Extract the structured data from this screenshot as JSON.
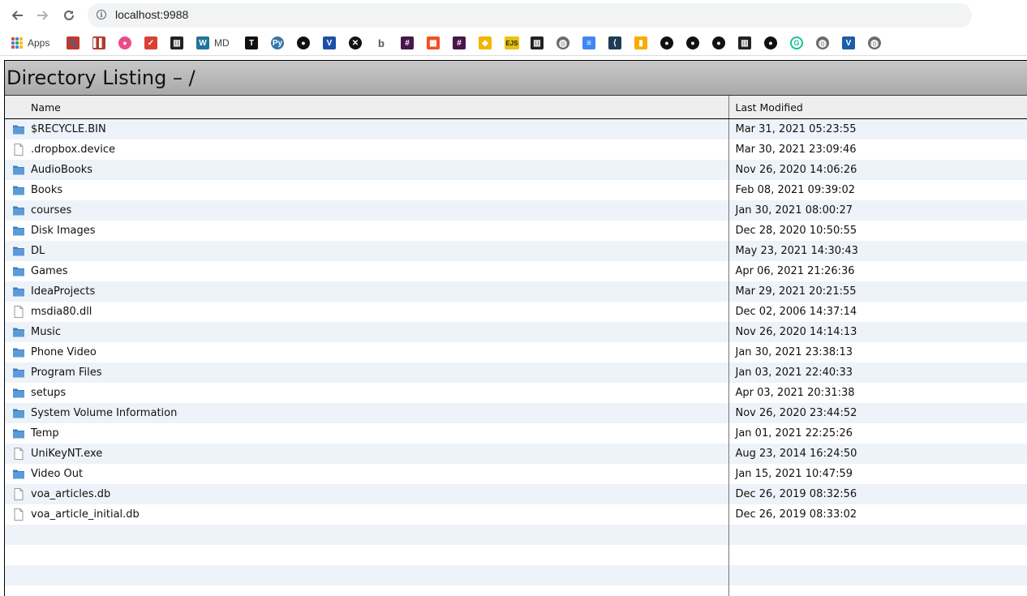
{
  "browser": {
    "url": "localhost:9988",
    "bookmarks": [
      {
        "label": "Apps",
        "icon": "apps-grid-icon"
      },
      {
        "label": "",
        "icon": "paw-icon",
        "color": "#c0392b",
        "glyph": "🐾"
      },
      {
        "label": "",
        "icon": "bars-icon",
        "color": "#b03a2e",
        "glyph": "▌▌"
      },
      {
        "label": "",
        "icon": "dribbble-icon",
        "color": "#ea4c89",
        "glyph": "●"
      },
      {
        "label": "",
        "icon": "check-icon",
        "color": "#db4035",
        "glyph": "✓"
      },
      {
        "label": "",
        "icon": "museum-icon",
        "color": "#222222",
        "glyph": "▥"
      },
      {
        "label": "MD",
        "icon": "wordpress-icon",
        "color": "#21759b",
        "glyph": "W"
      },
      {
        "label": "",
        "icon": "tb-icon",
        "color": "#111111",
        "glyph": "T"
      },
      {
        "label": "",
        "icon": "python-icon",
        "color": "#3776ab",
        "glyph": "Py"
      },
      {
        "label": "",
        "icon": "github-icon",
        "color": "#111111",
        "glyph": "●"
      },
      {
        "label": "",
        "icon": "v-icon",
        "color": "#1e4fa8",
        "glyph": "V"
      },
      {
        "label": "",
        "icon": "x-icon",
        "color": "#111111",
        "glyph": "✕"
      },
      {
        "label": "",
        "icon": "b-icon",
        "color": "#555555",
        "glyph": "b"
      },
      {
        "label": "",
        "icon": "slack-icon",
        "color": "#4a154b",
        "glyph": "#"
      },
      {
        "label": "",
        "icon": "microsoft-icon",
        "color": "#f25022",
        "glyph": "▦"
      },
      {
        "label": "",
        "icon": "hash-icon",
        "color": "#4a154b",
        "glyph": "#"
      },
      {
        "label": "",
        "icon": "bag-icon",
        "color": "#f4b400",
        "glyph": "◆"
      },
      {
        "label": "",
        "icon": "ejs-icon",
        "color": "#e8c20c",
        "glyph": "EJS"
      },
      {
        "label": "",
        "icon": "museum-icon",
        "color": "#222222",
        "glyph": "▥"
      },
      {
        "label": "",
        "icon": "globe-icon",
        "color": "#6b6b6b",
        "glyph": "◍"
      },
      {
        "label": "",
        "icon": "docs-icon",
        "color": "#4285f4",
        "glyph": "≡"
      },
      {
        "label": "",
        "icon": "vscode-icon",
        "color": "#1f3b57",
        "glyph": "⟨"
      },
      {
        "label": "",
        "icon": "analytics-icon",
        "color": "#f9ab00",
        "glyph": "▮"
      },
      {
        "label": "",
        "icon": "github-icon",
        "color": "#111111",
        "glyph": "●"
      },
      {
        "label": "",
        "icon": "github-icon",
        "color": "#111111",
        "glyph": "●"
      },
      {
        "label": "",
        "icon": "github-icon",
        "color": "#111111",
        "glyph": "●"
      },
      {
        "label": "",
        "icon": "museum-icon",
        "color": "#222222",
        "glyph": "▥"
      },
      {
        "label": "",
        "icon": "github-icon",
        "color": "#111111",
        "glyph": "●"
      },
      {
        "label": "",
        "icon": "grammarly-icon",
        "color": "#15c39a",
        "glyph": "G"
      },
      {
        "label": "",
        "icon": "globe-icon",
        "color": "#6b6b6b",
        "glyph": "◍"
      },
      {
        "label": "",
        "icon": "voa-icon",
        "color": "#1a5fa8",
        "glyph": "V"
      },
      {
        "label": "",
        "icon": "globe-icon",
        "color": "#6b6b6b",
        "glyph": "◍"
      }
    ]
  },
  "listing": {
    "title": "Directory Listing – /",
    "columns": {
      "name": "Name",
      "modified": "Last Modified"
    },
    "rows": [
      {
        "name": "$RECYCLE.BIN",
        "modified": "Mar 31, 2021 05:23:55",
        "type": "folder"
      },
      {
        "name": ".dropbox.device",
        "modified": "Mar 30, 2021 23:09:46",
        "type": "file"
      },
      {
        "name": "AudioBooks",
        "modified": "Nov 26, 2020 14:06:26",
        "type": "folder"
      },
      {
        "name": "Books",
        "modified": "Feb 08, 2021 09:39:02",
        "type": "folder"
      },
      {
        "name": "courses",
        "modified": "Jan 30, 2021 08:00:27",
        "type": "folder"
      },
      {
        "name": "Disk Images",
        "modified": "Dec 28, 2020 10:50:55",
        "type": "folder"
      },
      {
        "name": "DL",
        "modified": "May 23, 2021 14:30:43",
        "type": "folder"
      },
      {
        "name": "Games",
        "modified": "Apr 06, 2021 21:26:36",
        "type": "folder"
      },
      {
        "name": "IdeaProjects",
        "modified": "Mar 29, 2021 20:21:55",
        "type": "folder"
      },
      {
        "name": "msdia80.dll",
        "modified": "Dec 02, 2006 14:37:14",
        "type": "file"
      },
      {
        "name": "Music",
        "modified": "Nov 26, 2020 14:14:13",
        "type": "folder"
      },
      {
        "name": "Phone Video",
        "modified": "Jan 30, 2021 23:38:13",
        "type": "folder"
      },
      {
        "name": "Program Files",
        "modified": "Jan 03, 2021 22:40:33",
        "type": "folder"
      },
      {
        "name": "setups",
        "modified": "Apr 03, 2021 20:31:38",
        "type": "folder"
      },
      {
        "name": "System Volume Information",
        "modified": "Nov 26, 2020 23:44:52",
        "type": "folder"
      },
      {
        "name": "Temp",
        "modified": "Jan 01, 2021 22:25:26",
        "type": "folder"
      },
      {
        "name": "UniKeyNT.exe",
        "modified": "Aug 23, 2014 16:24:50",
        "type": "file"
      },
      {
        "name": "Video Out",
        "modified": "Jan 15, 2021 10:47:59",
        "type": "folder"
      },
      {
        "name": "voa_articles.db",
        "modified": "Dec 26, 2019 08:32:56",
        "type": "file"
      },
      {
        "name": "voa_article_initial.db",
        "modified": "Dec 26, 2019 08:33:02",
        "type": "file"
      }
    ]
  },
  "colors": {
    "folder": "#5a9bd8",
    "folder_dark": "#3d7fc0",
    "row_stripe": "#eef3f9",
    "header_bar": "#b5b5b5"
  }
}
